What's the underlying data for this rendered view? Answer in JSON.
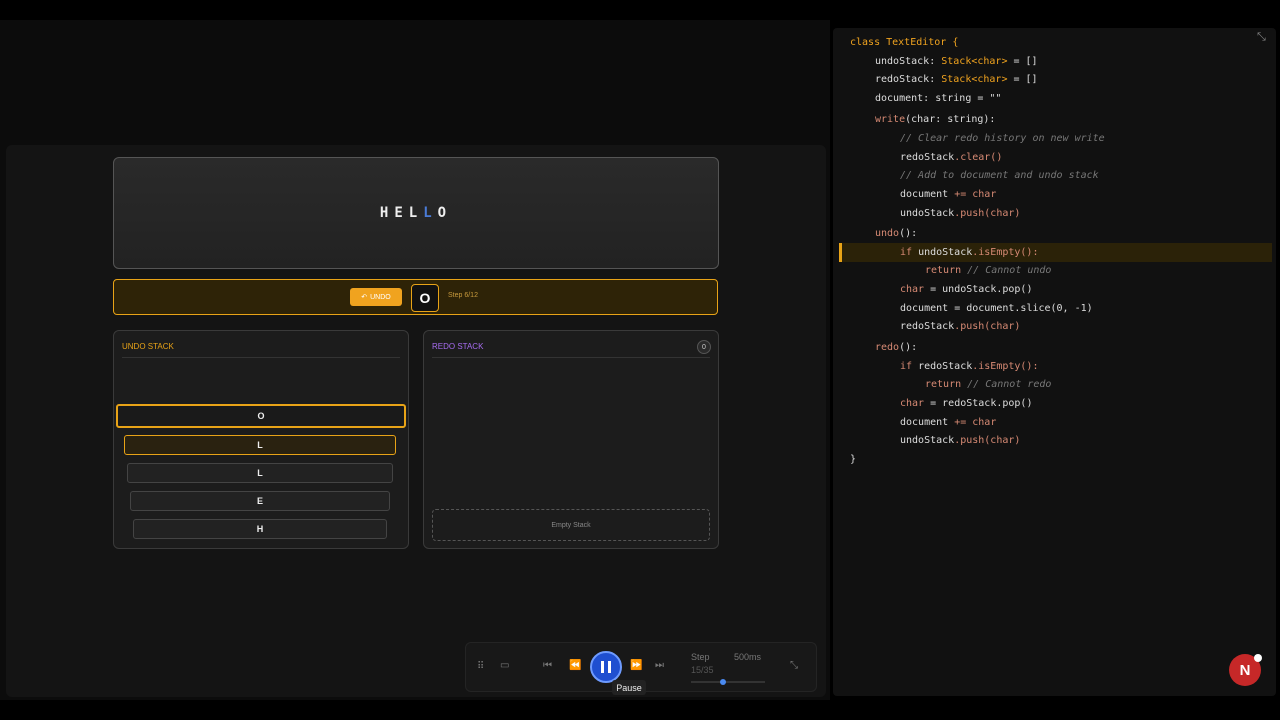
{
  "document_display": {
    "text_before": "HEL",
    "text_highlight": "L",
    "text_after": "O"
  },
  "action": {
    "button_label": "UNDO",
    "current_char": "O",
    "step": "Step 6/12"
  },
  "undo_stack": {
    "title": "UNDO STACK",
    "items": [
      "O",
      "L",
      "L",
      "E",
      "H"
    ]
  },
  "redo_stack": {
    "title": "REDO STACK",
    "count": "0",
    "empty_label": "Empty Stack"
  },
  "controls": {
    "step_label": "Step",
    "step_value": "15/35",
    "speed": "500ms",
    "tooltip": "Pause",
    "progress": 0.43
  },
  "code": {
    "l1": "class TextEditor {",
    "l2a": "undoStack",
    "l2b": ": ",
    "l2c": "Stack<char>",
    "l2d": " = []",
    "l3a": "redoStack",
    "l3b": ": ",
    "l3c": "Stack<char>",
    "l3d": " = []",
    "l4a": "document",
    "l4b": ": string = \"\"",
    "l5a": "write",
    "l5b": "(char: string):",
    "l6": "// Clear redo history on new write",
    "l7a": "redoStack",
    ".l7b": "",
    "l7b": ".clear()",
    "l8": "// Add to document and undo stack",
    "l9a": "document",
    "l9b": " += char",
    "l10a": "undoStack",
    "l10b": ".push(char)",
    "l11a": "undo",
    "l11b": "():",
    "l12a": "if ",
    "l12b": "undoStack",
    "l12c": ".isEmpty():",
    "l13a": "return ",
    "l13b": "// Cannot undo",
    "l14a": "char",
    "l14b": " = undoStack.pop()",
    "l15a": "document",
    "l15b": " = document.slice(0, -1)",
    "l16a": "redoStack",
    "l16b": ".push(char)",
    "l17a": "redo",
    "l17b": "():",
    "l18a": "if ",
    "l18b": "redoStack",
    "l18c": ".isEmpty():",
    "l19a": "return ",
    "l19b": "// Cannot redo",
    "l20a": "char",
    "l20b": " = redoStack.pop()",
    "l21a": "document",
    "l21b": " += char",
    "l22a": "undoStack",
    "l22b": ".push(char)",
    "l23": "}"
  },
  "badge": {
    "letter": "N"
  },
  "colors": {
    "accent": "#e8a317",
    "redo_title": "#a66cf0",
    "play": "#1f4fd0"
  }
}
